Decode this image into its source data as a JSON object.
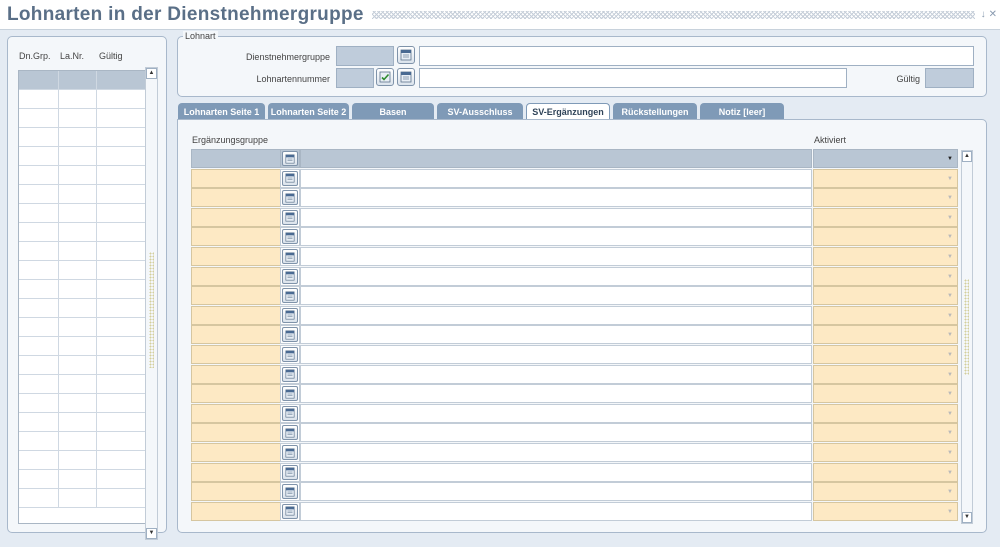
{
  "window": {
    "title": "Lohnarten in der Dienstnehmergruppe",
    "controls": [
      "↓",
      "✕"
    ]
  },
  "left_list": {
    "headers": [
      "Dn.Grp.",
      "La.Nr.",
      "Gültig"
    ],
    "rows": 23
  },
  "lohnart": {
    "legend": "Lohnart",
    "dienstnehmergruppe_label": "Dienstnehmergruppe",
    "dienstnehmergruppe_value": "",
    "dienstnehmergruppe_text": "",
    "lohnartennummer_label": "Lohnartennummer",
    "lohnartennummer_value": "",
    "lohnartennummer_text": "",
    "gueltig_label": "Gültig",
    "gueltig_value": ""
  },
  "tabs": [
    {
      "label": "Lohnarten Seite 1"
    },
    {
      "label": "Lohnarten Seite 2"
    },
    {
      "label": "Basen"
    },
    {
      "label": "SV-Ausschluss"
    },
    {
      "label": "SV-Ergänzungen"
    },
    {
      "label": "Rückstellungen"
    },
    {
      "label": "Notiz [leer]"
    }
  ],
  "active_tab": "SV-Ergänzungen",
  "grid": {
    "col_ergaenzungsgruppe": "Ergänzungsgruppe",
    "col_aktiviert": "Aktiviert",
    "rows": 19
  },
  "colors": {
    "title": "#5a6f87",
    "tab": "#7f9ab7",
    "highlight_row": "#b9c6d4",
    "required_field": "#fde9c4"
  },
  "icons": {
    "lov": "calendar-list-icon",
    "validate": "checkmark-icon",
    "dropdown": "dropdown-arrow-icon",
    "scroll_up": "scroll-up-icon",
    "scroll_down": "scroll-down-icon"
  }
}
